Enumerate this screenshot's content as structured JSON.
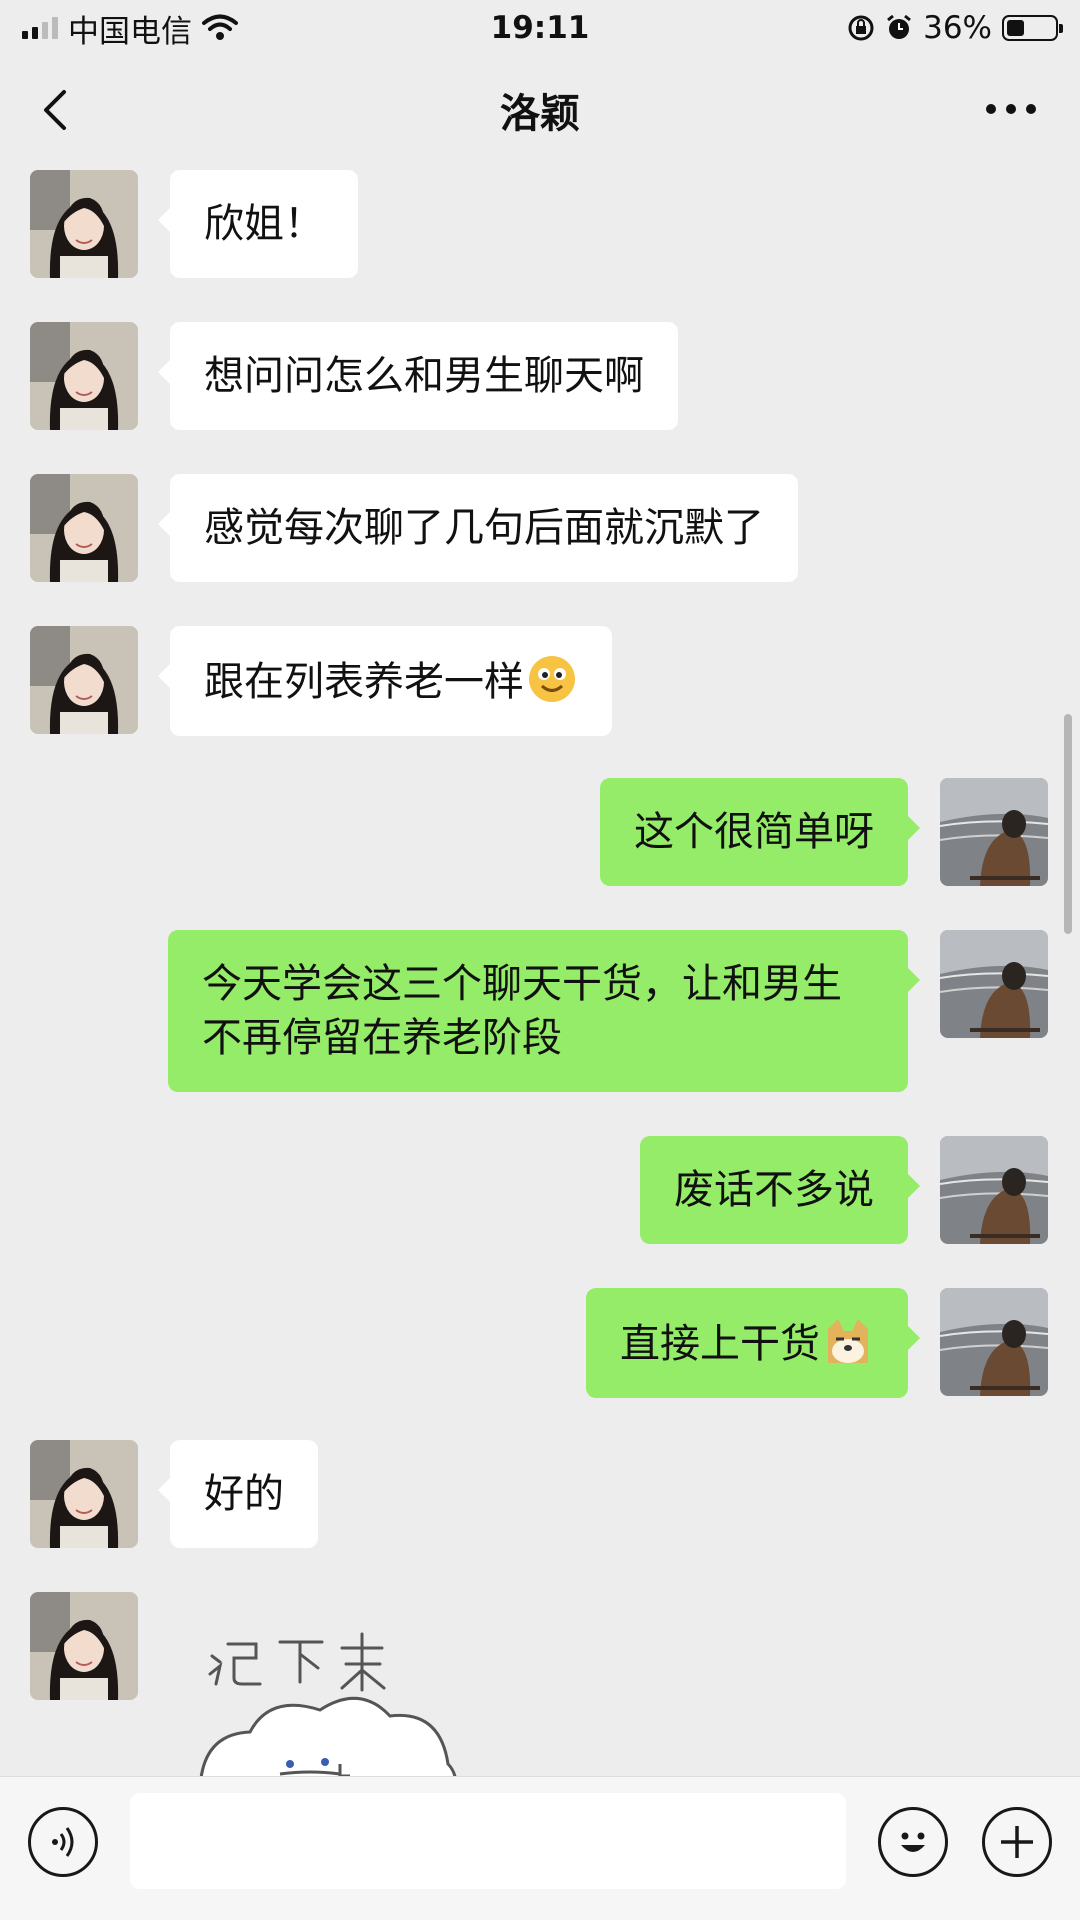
{
  "status_bar": {
    "carrier": "中国电信",
    "time": "19:11",
    "battery": "36%",
    "battery_level": 0.36
  },
  "header": {
    "title": "洛颖"
  },
  "messages": [
    {
      "side": "left",
      "text": "欣姐！"
    },
    {
      "side": "left",
      "text": "想问问怎么和男生聊天啊"
    },
    {
      "side": "left",
      "text": "感觉每次聊了几句后面就沉默了"
    },
    {
      "side": "left",
      "text": "跟在列表养老一样",
      "emoji": "grinning-face-emoji"
    },
    {
      "side": "right",
      "text": "这个很简单呀"
    },
    {
      "side": "right",
      "text": "今天学会这三个聊天干货，让和男生不再停留在养老阶段"
    },
    {
      "side": "right",
      "text": "废话不多说"
    },
    {
      "side": "right",
      "text": "直接上干货",
      "emoji": "doge-emoji"
    },
    {
      "side": "left",
      "text": "好的"
    },
    {
      "side": "left",
      "sticker_text": "记下来"
    }
  ],
  "input": {
    "placeholder": ""
  },
  "icons": {
    "back": "chevron-left-icon",
    "more": "more-dots-icon",
    "voice": "voice-icon",
    "emoji": "smiley-icon",
    "plus": "plus-icon"
  },
  "colors": {
    "background": "#ededed",
    "sent_bubble": "#95ec69",
    "received_bubble": "#ffffff"
  }
}
